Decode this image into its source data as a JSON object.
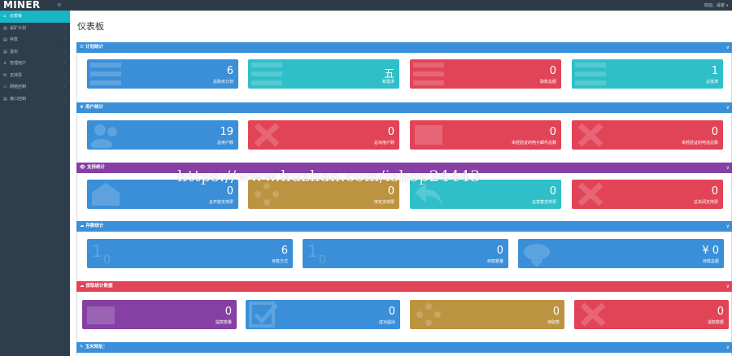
{
  "topbar": {
    "logo": "MINER",
    "menu_icon": "≡",
    "user_text": "欢迎，请谢 ∨"
  },
  "sidebar": {
    "items": [
      {
        "icon": "⌂",
        "label": "仪表板",
        "active": true
      },
      {
        "icon": "▤",
        "label": "采矿计划",
        "chevron": "‹"
      },
      {
        "icon": "▤",
        "label": "存款",
        "chevron": "‹"
      },
      {
        "icon": "▤",
        "label": "退出",
        "chevron": "‹"
      },
      {
        "icon": "♙",
        "label": "管理用户",
        "chevron": "‹"
      },
      {
        "icon": "✉",
        "label": "支持票",
        "chevron": "‹"
      },
      {
        "icon": "▭",
        "label": "网络控制",
        "chevron": "‹"
      },
      {
        "icon": "▤",
        "label": "接口控制",
        "chevron": "‹"
      }
    ]
  },
  "page_title": "仪表板",
  "panels": [
    {
      "title": "计划统计",
      "icon": "☰",
      "chevron": "∨",
      "tiles": [
        {
          "value": "6",
          "label": "总购买计划"
        },
        {
          "value": "五",
          "label": "新需求"
        },
        {
          "value": "0",
          "label": "取款总额"
        },
        {
          "value": "1",
          "label": "总批准"
        }
      ]
    },
    {
      "title": "用户统计",
      "icon": "♛",
      "chevron": "∨",
      "tiles": [
        {
          "value": "19",
          "label": "总用户数"
        },
        {
          "value": "0",
          "label": "总块用户数"
        },
        {
          "value": "0",
          "label": "未经验证的电子邮件总数"
        },
        {
          "value": "0",
          "label": "未经验证的电话总数"
        }
      ]
    },
    {
      "title": "支持统计",
      "icon": "👁",
      "chevron": "∨",
      "tiles": [
        {
          "value": "0",
          "label": "总开放支持票"
        },
        {
          "value": "0",
          "label": "待定支持票"
        },
        {
          "value": "0",
          "label": "总答案支持票"
        },
        {
          "value": "0",
          "label": "总关闭支持票"
        }
      ]
    },
    {
      "title": "存款统计",
      "icon": "☁",
      "chevron": "∨",
      "tiles": [
        {
          "value": "6",
          "label": "存款方式"
        },
        {
          "value": "0",
          "label": "存款数量"
        },
        {
          "value": "¥ 0",
          "label": "存款总额"
        }
      ]
    },
    {
      "title": "提取统计数据",
      "icon": "☁",
      "chevron": "∨",
      "tiles": [
        {
          "value": "0",
          "label": "提款数量"
        },
        {
          "value": "0",
          "label": "成功提出"
        },
        {
          "value": "0",
          "label": "待取款"
        },
        {
          "value": "0",
          "label": "退款数额"
        }
      ]
    },
    {
      "title": "玉米网址：",
      "icon": "✎",
      "chevron": "∨",
      "tiles": []
    }
  ],
  "watermark": "https://www.huzhan.com/ishop24443",
  "colors": {
    "blue": "#3a8fd8",
    "teal": "#2fbfc9",
    "red": "#e24457",
    "gold": "#bc9340",
    "purple": "#8640a4",
    "sidebar": "#2e3e4d",
    "active": "#18b5c4"
  }
}
